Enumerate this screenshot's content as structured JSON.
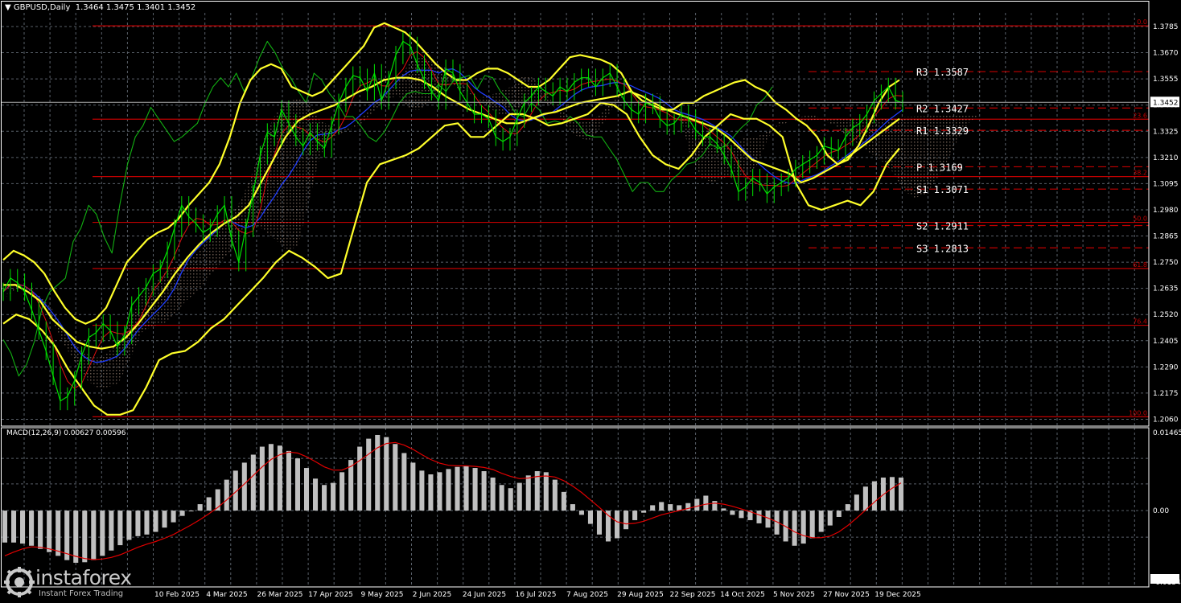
{
  "header": {
    "symbol_label": "GBPUSD,Daily",
    "ohlc": "1.3464 1.3475 1.3401 1.3452"
  },
  "macd_header": {
    "label": "MACD(12,26,9) 0.00627 0.00596"
  },
  "logo": {
    "brand": "instaforex",
    "tagline": "Instant Forex Trading"
  },
  "colors": {
    "background": "#000000",
    "grid": "#596069",
    "price_line": "#00e000",
    "chikou": "#12b012",
    "bollinger": "#ffff2a",
    "kijun": "#1f3dff",
    "tenkan": "#e01010",
    "fib": "#c00000",
    "pivot_dash": "#c00000",
    "macd_bar": "#c0c0c0",
    "macd_signal": "#e00000",
    "cloud": "#d8b6a0"
  },
  "chart_data": [
    {
      "type": "line",
      "title": "GBPUSD,Daily",
      "ylim": [
        1.203,
        1.3845
      ],
      "yticks": [
        1.3785,
        1.367,
        1.3555,
        1.344,
        1.3325,
        1.321,
        1.3095,
        1.298,
        1.2865,
        1.275,
        1.2635,
        1.252,
        1.2405,
        1.229,
        1.2175,
        1.206
      ],
      "ytick_labels": [
        "1.3785",
        "1.3670",
        "1.3555",
        "1.3440",
        "1.3325",
        "1.3210",
        "1.3095",
        "1.2980",
        "1.2865",
        "1.2750",
        "1.2635",
        "1.2520",
        "1.2405",
        "1.2290",
        "1.2175",
        "1.2060"
      ],
      "x_labels": [
        "10 Feb 2025",
        "4 Mar 2025",
        "26 Mar 2025",
        "17 Apr 2025",
        "9 May 2025",
        "2 Jun 2025",
        "24 Jun 2025",
        "16 Jul 2025",
        "7 Aug 2025",
        "29 Aug 2025",
        "22 Sep 2025",
        "14 Oct 2025",
        "5 Nov 2025",
        "27 Nov 2025",
        "19 Dec 2025"
      ],
      "current_price": 1.3452,
      "current_price_label": "1.3452",
      "fib_levels": [
        {
          "label": "0.0",
          "value": 1.3788
        },
        {
          "label": "23.6",
          "value": 1.3378
        },
        {
          "label": "38.2",
          "value": 1.3126
        },
        {
          "label": "50.0",
          "value": 1.2925
        },
        {
          "label": "61.8",
          "value": 1.2722
        },
        {
          "label": "76.4",
          "value": 1.2473
        },
        {
          "label": "100.0",
          "value": 1.2071
        }
      ],
      "pivots": [
        {
          "name": "R3",
          "value": 1.3587,
          "label": "1.3587"
        },
        {
          "name": "R2",
          "value": 1.3427,
          "label": "1.3427"
        },
        {
          "name": "R1",
          "value": 1.3329,
          "label": "1.3329"
        },
        {
          "name": "P",
          "value": 1.3169,
          "label": "1.3169"
        },
        {
          "name": "S1",
          "value": 1.3071,
          "label": "1.3071"
        },
        {
          "name": "S2",
          "value": 1.2911,
          "label": "1.2911"
        },
        {
          "name": "S3",
          "value": 1.2813,
          "label": "1.2813"
        }
      ],
      "series": [
        {
          "name": "price",
          "values": [
            1.262,
            1.268,
            1.266,
            1.262,
            1.254,
            1.245,
            1.236,
            1.225,
            1.214,
            1.216,
            1.223,
            1.234,
            1.242,
            1.244,
            1.248,
            1.245,
            1.238,
            1.243,
            1.256,
            1.26,
            1.264,
            1.27,
            1.272,
            1.28,
            1.29,
            1.3,
            1.295,
            1.292,
            1.288,
            1.29,
            1.296,
            1.3,
            1.285,
            1.275,
            1.29,
            1.305,
            1.322,
            1.332,
            1.33,
            1.342,
            1.336,
            1.33,
            1.326,
            1.332,
            1.328,
            1.325,
            1.335,
            1.345,
            1.352,
            1.357,
            1.356,
            1.35,
            1.358,
            1.346,
            1.355,
            1.366,
            1.372,
            1.37,
            1.362,
            1.355,
            1.35,
            1.346,
            1.36,
            1.358,
            1.35,
            1.345,
            1.34,
            1.34,
            1.338,
            1.33,
            1.328,
            1.33,
            1.338,
            1.345,
            1.348,
            1.352,
            1.35,
            1.348,
            1.352,
            1.35,
            1.354,
            1.356,
            1.356,
            1.352,
            1.356,
            1.358,
            1.352,
            1.346,
            1.342,
            1.34,
            1.345,
            1.344,
            1.338,
            1.335,
            1.336,
            1.34,
            1.338,
            1.333,
            1.33,
            1.33,
            1.327,
            1.322,
            1.316,
            1.306,
            1.308,
            1.312,
            1.31,
            1.305,
            1.308,
            1.31,
            1.312,
            1.316,
            1.318,
            1.32,
            1.322,
            1.326,
            1.325,
            1.324,
            1.33,
            1.334,
            1.336,
            1.34,
            1.346,
            1.349,
            1.352,
            1.346,
            1.345
          ]
        },
        {
          "name": "chikou",
          "values": [
            1.241,
            1.235,
            1.225,
            1.23,
            1.24,
            1.255,
            1.262,
            1.265,
            1.268,
            1.284,
            1.29,
            1.3,
            1.296,
            1.286,
            1.279,
            1.3,
            1.318,
            1.33,
            1.335,
            1.343,
            1.338,
            1.333,
            1.328,
            1.33,
            1.333,
            1.336,
            1.345,
            1.352,
            1.356,
            1.352,
            1.358,
            1.35,
            1.356,
            1.365,
            1.372,
            1.367,
            1.36,
            1.356,
            1.35,
            1.345,
            1.358,
            1.355,
            1.349,
            1.345,
            1.339,
            1.339,
            1.335,
            1.33,
            1.328,
            1.332,
            1.338,
            1.345,
            1.349,
            1.35,
            1.349,
            1.349,
            1.353,
            1.35,
            1.355,
            1.356,
            1.357,
            1.351,
            1.357,
            1.356,
            1.35,
            1.346,
            1.34,
            1.339,
            1.345,
            1.342,
            1.336,
            1.337,
            1.336,
            1.339,
            1.336,
            1.331,
            1.33,
            1.33,
            1.325,
            1.32,
            1.313,
            1.306,
            1.31,
            1.31,
            1.306,
            1.306,
            1.311,
            1.314,
            1.318,
            1.319,
            1.322,
            1.327,
            1.325,
            1.326,
            1.33,
            1.334,
            1.337,
            1.344,
            1.347,
            1.352
          ]
        },
        {
          "name": "bollinger_upper",
          "values": [
            1.276,
            1.28,
            1.278,
            1.275,
            1.27,
            1.262,
            1.255,
            1.25,
            1.248,
            1.25,
            1.255,
            1.265,
            1.275,
            1.28,
            1.285,
            1.288,
            1.29,
            1.294,
            1.3,
            1.305,
            1.31,
            1.318,
            1.33,
            1.345,
            1.355,
            1.36,
            1.362,
            1.36,
            1.352,
            1.35,
            1.348,
            1.35,
            1.355,
            1.36,
            1.365,
            1.37,
            1.378,
            1.38,
            1.378,
            1.376,
            1.372,
            1.367,
            1.362,
            1.358,
            1.355,
            1.355,
            1.358,
            1.36,
            1.36,
            1.358,
            1.355,
            1.352,
            1.352,
            1.355,
            1.36,
            1.365,
            1.366,
            1.365,
            1.364,
            1.362,
            1.358,
            1.35,
            1.346,
            1.344,
            1.342,
            1.342,
            1.345,
            1.345,
            1.348,
            1.35,
            1.352,
            1.354,
            1.355,
            1.352,
            1.35,
            1.345,
            1.342,
            1.338,
            1.335,
            1.33,
            1.322,
            1.318,
            1.32,
            1.326,
            1.335,
            1.345,
            1.352,
            1.355
          ]
        },
        {
          "name": "bollinger_middle",
          "values": [
            1.265,
            1.265,
            1.262,
            1.258,
            1.25,
            1.245,
            1.24,
            1.238,
            1.237,
            1.238,
            1.242,
            1.248,
            1.255,
            1.262,
            1.27,
            1.277,
            1.283,
            1.288,
            1.292,
            1.295,
            1.3,
            1.31,
            1.32,
            1.33,
            1.337,
            1.34,
            1.342,
            1.344,
            1.347,
            1.35,
            1.352,
            1.355,
            1.356,
            1.356,
            1.355,
            1.352,
            1.348,
            1.345,
            1.342,
            1.34,
            1.338,
            1.336,
            1.336,
            1.338,
            1.34,
            1.341,
            1.343,
            1.345,
            1.346,
            1.347,
            1.348,
            1.35,
            1.348,
            1.345,
            1.342,
            1.34,
            1.338,
            1.336,
            1.334,
            1.33,
            1.325,
            1.32,
            1.318,
            1.316,
            1.314,
            1.31,
            1.312,
            1.315,
            1.318,
            1.322,
            1.326,
            1.33,
            1.334,
            1.338
          ]
        },
        {
          "name": "bollinger_lower",
          "values": [
            1.248,
            1.252,
            1.25,
            1.245,
            1.238,
            1.228,
            1.22,
            1.212,
            1.208,
            1.208,
            1.21,
            1.22,
            1.232,
            1.235,
            1.236,
            1.24,
            1.246,
            1.25,
            1.256,
            1.262,
            1.268,
            1.275,
            1.28,
            1.277,
            1.273,
            1.268,
            1.27,
            1.29,
            1.31,
            1.318,
            1.32,
            1.322,
            1.325,
            1.33,
            1.335,
            1.336,
            1.33,
            1.33,
            1.335,
            1.34,
            1.34,
            1.338,
            1.335,
            1.336,
            1.338,
            1.34,
            1.345,
            1.344,
            1.34,
            1.33,
            1.322,
            1.318,
            1.316,
            1.322,
            1.33,
            1.335,
            1.34,
            1.338,
            1.338,
            1.335,
            1.33,
            1.31,
            1.3,
            1.298,
            1.3,
            1.302,
            1.3,
            1.306,
            1.318,
            1.325
          ]
        }
      ]
    },
    {
      "type": "bar",
      "title": "MACD(12,26,9) 0.00627 0.00596",
      "ylim": [
        -0.01343,
        0.01465
      ],
      "yticks": [
        0.01465,
        0.0,
        -0.01343
      ],
      "ytick_labels": [
        "0.01465",
        "0.00",
        "-0.01343"
      ],
      "series": [
        {
          "name": "macd",
          "values": [
            -0.006,
            -0.006,
            -0.0062,
            -0.0066,
            -0.0072,
            -0.0078,
            -0.0085,
            -0.0093,
            -0.0098,
            -0.0097,
            -0.0093,
            -0.0085,
            -0.0075,
            -0.0065,
            -0.0055,
            -0.0048,
            -0.0045,
            -0.004,
            -0.0032,
            -0.0022,
            -0.001,
            0.0,
            0.0012,
            0.0025,
            0.004,
            0.0058,
            0.0075,
            0.009,
            0.0105,
            0.012,
            0.0125,
            0.0122,
            0.0112,
            0.0098,
            0.008,
            0.006,
            0.0048,
            0.0052,
            0.0072,
            0.0095,
            0.012,
            0.0135,
            0.0142,
            0.0138,
            0.0125,
            0.0108,
            0.009,
            0.0075,
            0.0068,
            0.0072,
            0.0078,
            0.0082,
            0.0083,
            0.008,
            0.0074,
            0.0062,
            0.0048,
            0.0042,
            0.0052,
            0.0066,
            0.0074,
            0.0072,
            0.0058,
            0.0035,
            0.0012,
            -0.0008,
            -0.0025,
            -0.0045,
            -0.0058,
            -0.0052,
            -0.0035,
            -0.0018,
            -0.0004,
            0.001,
            0.0016,
            0.0012,
            0.001,
            0.0014,
            0.0022,
            0.0028,
            0.0018,
            0.0004,
            -0.0008,
            -0.0014,
            -0.0018,
            -0.0024,
            -0.0032,
            -0.0045,
            -0.0058,
            -0.0066,
            -0.0062,
            -0.0052,
            -0.004,
            -0.0028,
            -0.0012,
            0.0012,
            0.003,
            0.0045,
            0.0055,
            0.0062,
            0.0063,
            0.0062
          ]
        },
        {
          "name": "signal",
          "values": [
            -0.0085,
            -0.0078,
            -0.0072,
            -0.0068,
            -0.0069,
            -0.0072,
            -0.0076,
            -0.0081,
            -0.0086,
            -0.009,
            -0.0092,
            -0.0091,
            -0.0088,
            -0.0083,
            -0.0076,
            -0.0069,
            -0.0063,
            -0.0058,
            -0.0052,
            -0.0045,
            -0.0036,
            -0.0027,
            -0.0017,
            -0.0006,
            0.0006,
            0.002,
            0.0035,
            0.005,
            0.0066,
            0.0082,
            0.0096,
            0.0105,
            0.011,
            0.0108,
            0.0101,
            0.0092,
            0.0082,
            0.0076,
            0.0076,
            0.0083,
            0.0094,
            0.0106,
            0.0118,
            0.0126,
            0.0128,
            0.0123,
            0.0115,
            0.0105,
            0.0096,
            0.0089,
            0.0085,
            0.0084,
            0.0084,
            0.0083,
            0.0081,
            0.0077,
            0.007,
            0.0064,
            0.006,
            0.0061,
            0.0064,
            0.0065,
            0.0063,
            0.0056,
            0.0046,
            0.0034,
            0.002,
            0.0006,
            -0.0009,
            -0.0021,
            -0.0025,
            -0.0024,
            -0.002,
            -0.0014,
            -0.0008,
            -0.0004,
            0.0,
            0.0004,
            0.0008,
            0.0012,
            0.0014,
            0.0012,
            0.0008,
            0.0003,
            -0.0002,
            -0.0008,
            -0.0014,
            -0.0021,
            -0.003,
            -0.004,
            -0.0047,
            -0.0051,
            -0.0051,
            -0.0048,
            -0.004,
            -0.0028,
            -0.0014,
            0.0001,
            0.0016,
            0.003,
            0.0042,
            0.0052
          ]
        }
      ]
    }
  ]
}
